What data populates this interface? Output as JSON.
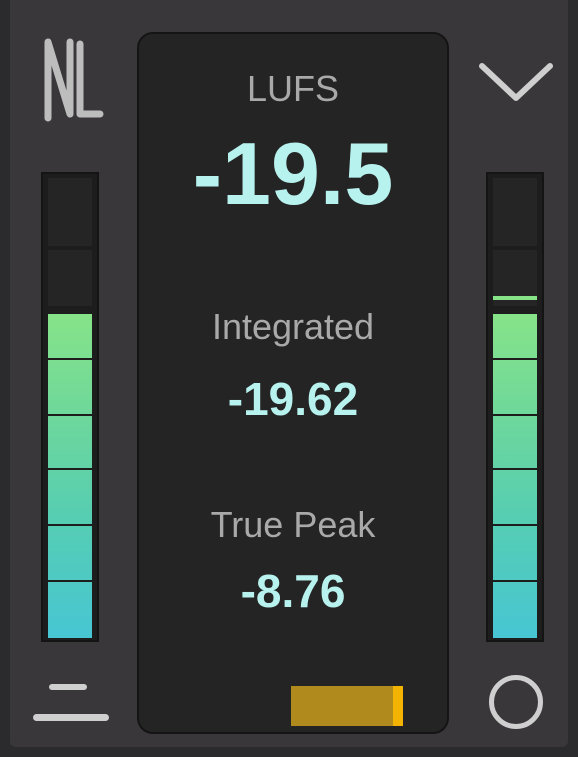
{
  "icons": {
    "logo": "nl-logo-icon",
    "collapse": "chevron-down-icon",
    "menu": "menu-lines-icon",
    "reset": "circle-icon"
  },
  "display": {
    "short_term_label": "LUFS",
    "short_term_value": "-19.5",
    "integrated_label": "Integrated",
    "integrated_value": "-19.62",
    "true_peak_label": "True Peak",
    "true_peak_value": "-8.76"
  },
  "meters": {
    "left_level": 0.7,
    "right_level": 0.7,
    "right_peak_hold": 0.74
  },
  "gain_indicator": {
    "color": "#b08a1c",
    "cap_color": "#f2b400"
  },
  "colors": {
    "value_text": "#b7f2ee",
    "meter_top": "#86e388",
    "meter_bottom": "#47c6d3"
  }
}
